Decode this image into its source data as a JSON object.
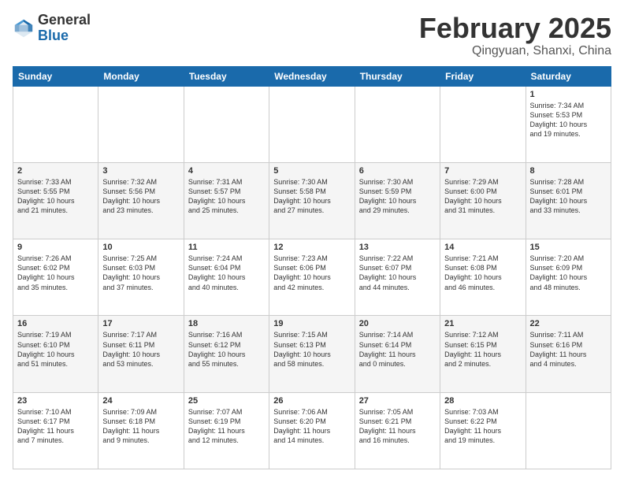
{
  "header": {
    "logo_general": "General",
    "logo_blue": "Blue",
    "month_title": "February 2025",
    "location": "Qingyuan, Shanxi, China"
  },
  "days_of_week": [
    "Sunday",
    "Monday",
    "Tuesday",
    "Wednesday",
    "Thursday",
    "Friday",
    "Saturday"
  ],
  "weeks": [
    [
      {
        "day": "",
        "info": ""
      },
      {
        "day": "",
        "info": ""
      },
      {
        "day": "",
        "info": ""
      },
      {
        "day": "",
        "info": ""
      },
      {
        "day": "",
        "info": ""
      },
      {
        "day": "",
        "info": ""
      },
      {
        "day": "1",
        "info": "Sunrise: 7:34 AM\nSunset: 5:53 PM\nDaylight: 10 hours\nand 19 minutes."
      }
    ],
    [
      {
        "day": "2",
        "info": "Sunrise: 7:33 AM\nSunset: 5:55 PM\nDaylight: 10 hours\nand 21 minutes."
      },
      {
        "day": "3",
        "info": "Sunrise: 7:32 AM\nSunset: 5:56 PM\nDaylight: 10 hours\nand 23 minutes."
      },
      {
        "day": "4",
        "info": "Sunrise: 7:31 AM\nSunset: 5:57 PM\nDaylight: 10 hours\nand 25 minutes."
      },
      {
        "day": "5",
        "info": "Sunrise: 7:30 AM\nSunset: 5:58 PM\nDaylight: 10 hours\nand 27 minutes."
      },
      {
        "day": "6",
        "info": "Sunrise: 7:30 AM\nSunset: 5:59 PM\nDaylight: 10 hours\nand 29 minutes."
      },
      {
        "day": "7",
        "info": "Sunrise: 7:29 AM\nSunset: 6:00 PM\nDaylight: 10 hours\nand 31 minutes."
      },
      {
        "day": "8",
        "info": "Sunrise: 7:28 AM\nSunset: 6:01 PM\nDaylight: 10 hours\nand 33 minutes."
      }
    ],
    [
      {
        "day": "9",
        "info": "Sunrise: 7:26 AM\nSunset: 6:02 PM\nDaylight: 10 hours\nand 35 minutes."
      },
      {
        "day": "10",
        "info": "Sunrise: 7:25 AM\nSunset: 6:03 PM\nDaylight: 10 hours\nand 37 minutes."
      },
      {
        "day": "11",
        "info": "Sunrise: 7:24 AM\nSunset: 6:04 PM\nDaylight: 10 hours\nand 40 minutes."
      },
      {
        "day": "12",
        "info": "Sunrise: 7:23 AM\nSunset: 6:06 PM\nDaylight: 10 hours\nand 42 minutes."
      },
      {
        "day": "13",
        "info": "Sunrise: 7:22 AM\nSunset: 6:07 PM\nDaylight: 10 hours\nand 44 minutes."
      },
      {
        "day": "14",
        "info": "Sunrise: 7:21 AM\nSunset: 6:08 PM\nDaylight: 10 hours\nand 46 minutes."
      },
      {
        "day": "15",
        "info": "Sunrise: 7:20 AM\nSunset: 6:09 PM\nDaylight: 10 hours\nand 48 minutes."
      }
    ],
    [
      {
        "day": "16",
        "info": "Sunrise: 7:19 AM\nSunset: 6:10 PM\nDaylight: 10 hours\nand 51 minutes."
      },
      {
        "day": "17",
        "info": "Sunrise: 7:17 AM\nSunset: 6:11 PM\nDaylight: 10 hours\nand 53 minutes."
      },
      {
        "day": "18",
        "info": "Sunrise: 7:16 AM\nSunset: 6:12 PM\nDaylight: 10 hours\nand 55 minutes."
      },
      {
        "day": "19",
        "info": "Sunrise: 7:15 AM\nSunset: 6:13 PM\nDaylight: 10 hours\nand 58 minutes."
      },
      {
        "day": "20",
        "info": "Sunrise: 7:14 AM\nSunset: 6:14 PM\nDaylight: 11 hours\nand 0 minutes."
      },
      {
        "day": "21",
        "info": "Sunrise: 7:12 AM\nSunset: 6:15 PM\nDaylight: 11 hours\nand 2 minutes."
      },
      {
        "day": "22",
        "info": "Sunrise: 7:11 AM\nSunset: 6:16 PM\nDaylight: 11 hours\nand 4 minutes."
      }
    ],
    [
      {
        "day": "23",
        "info": "Sunrise: 7:10 AM\nSunset: 6:17 PM\nDaylight: 11 hours\nand 7 minutes."
      },
      {
        "day": "24",
        "info": "Sunrise: 7:09 AM\nSunset: 6:18 PM\nDaylight: 11 hours\nand 9 minutes."
      },
      {
        "day": "25",
        "info": "Sunrise: 7:07 AM\nSunset: 6:19 PM\nDaylight: 11 hours\nand 12 minutes."
      },
      {
        "day": "26",
        "info": "Sunrise: 7:06 AM\nSunset: 6:20 PM\nDaylight: 11 hours\nand 14 minutes."
      },
      {
        "day": "27",
        "info": "Sunrise: 7:05 AM\nSunset: 6:21 PM\nDaylight: 11 hours\nand 16 minutes."
      },
      {
        "day": "28",
        "info": "Sunrise: 7:03 AM\nSunset: 6:22 PM\nDaylight: 11 hours\nand 19 minutes."
      },
      {
        "day": "",
        "info": ""
      }
    ]
  ]
}
